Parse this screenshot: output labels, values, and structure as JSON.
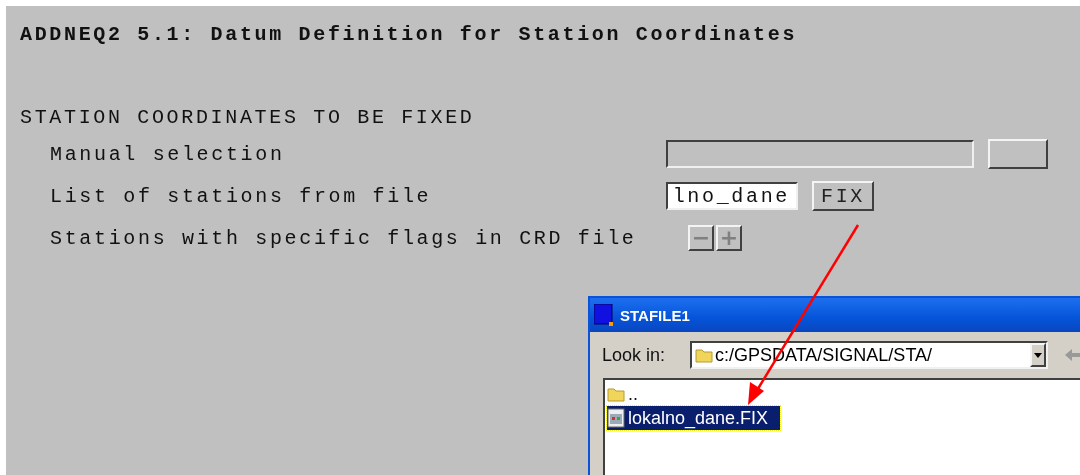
{
  "panel": {
    "title": "ADDNEQ2 5.1: Datum Definition for Station Coordinates",
    "section": "STATION COORDINATES TO BE FIXED",
    "rows": [
      {
        "kind": "field",
        "label": "Manual selection"
      },
      {
        "kind": "field",
        "label": "List of stations from file",
        "value": "lno_dane",
        "button": "FIX"
      },
      {
        "kind": "stepper",
        "label": "Stations with specific flags in CRD file",
        "minus": "−",
        "plus": "+"
      }
    ]
  },
  "dialog": {
    "title": "STAFILE1",
    "look_in_label": "Look in:",
    "path": "c:/GPSDATA/SIGNAL/STA/",
    "files": [
      {
        "kind": "folder",
        "name": "..",
        "selected": false
      },
      {
        "kind": "file",
        "name": "lokalno_dane.FIX",
        "selected": true
      }
    ]
  }
}
